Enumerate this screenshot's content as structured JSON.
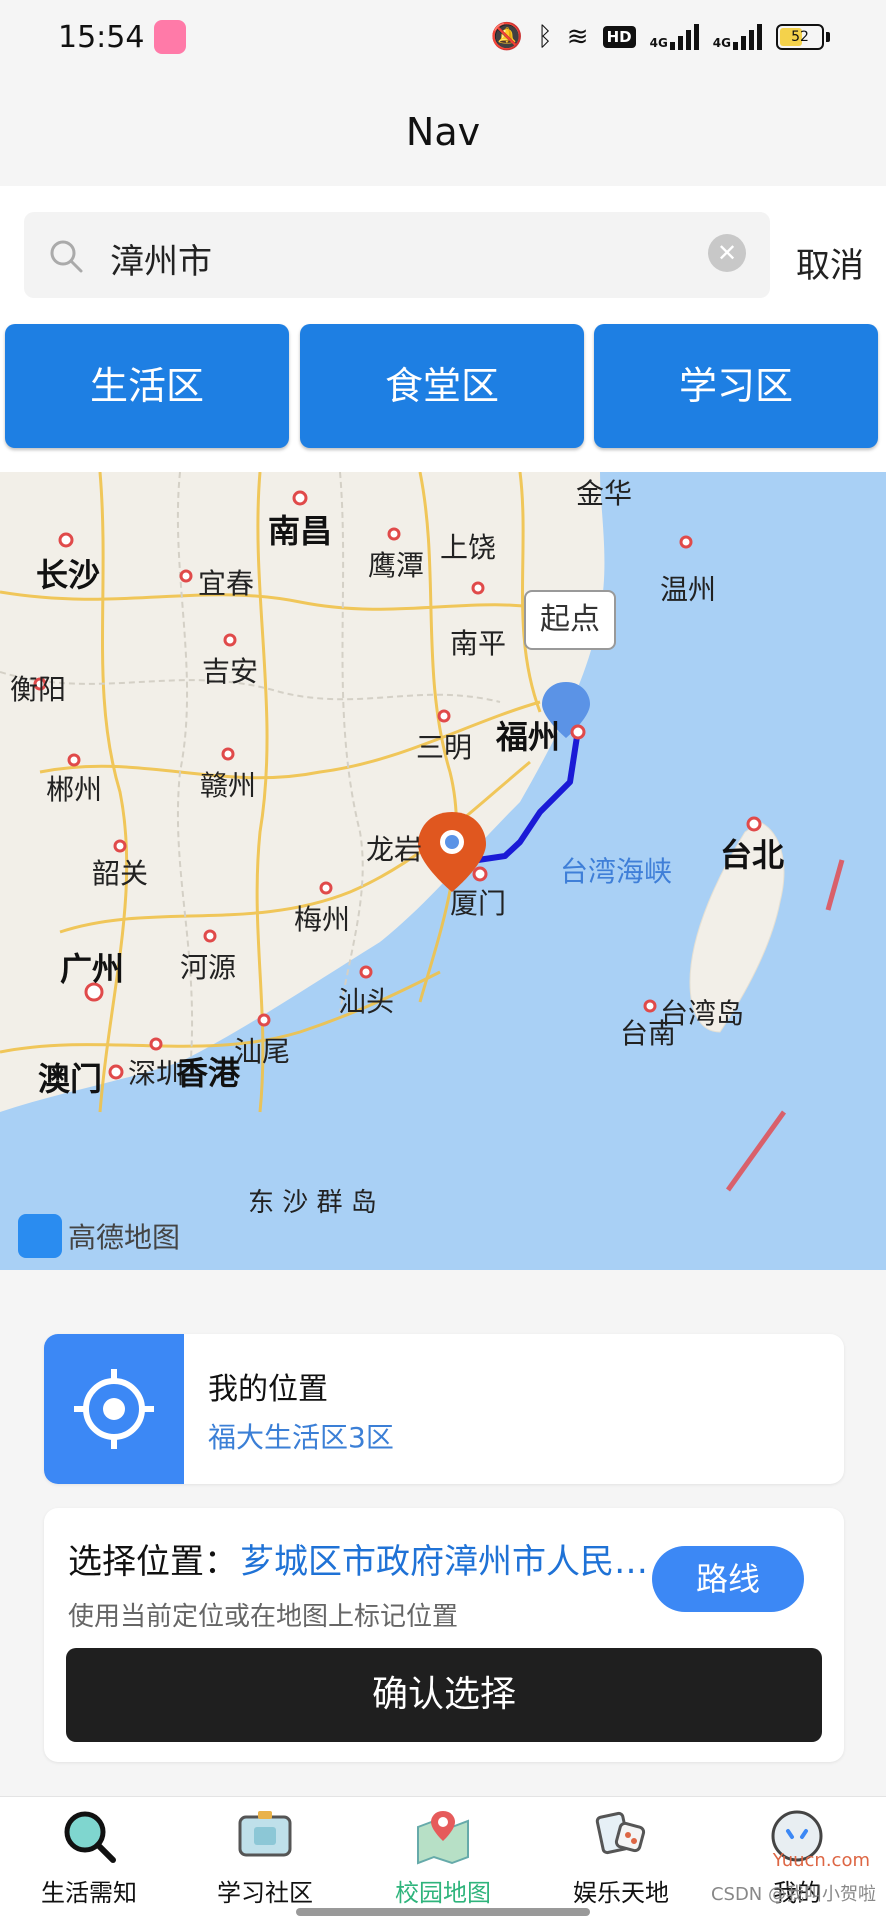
{
  "status_bar": {
    "time": "15:54",
    "icons": [
      "mute-icon",
      "bluetooth-icon",
      "wifi-icon",
      "hd-icon",
      "signal-4g-icon",
      "signal-4g-icon",
      "battery-icon"
    ],
    "hd_label": "HD",
    "network_label": "4G",
    "battery": "52"
  },
  "header": {
    "title": "Nav"
  },
  "search": {
    "value": "漳州市",
    "cancel_label": "取消"
  },
  "categories": [
    {
      "label": "生活区"
    },
    {
      "label": "食堂区"
    },
    {
      "label": "学习区"
    }
  ],
  "map": {
    "labels": [
      {
        "text": "南昌",
        "big": true
      },
      {
        "text": "长沙",
        "big": true
      },
      {
        "text": "宜春"
      },
      {
        "text": "鹰潭"
      },
      {
        "text": "上饶"
      },
      {
        "text": "金华"
      },
      {
        "text": "温州"
      },
      {
        "text": "南平"
      },
      {
        "text": "衡阳"
      },
      {
        "text": "吉安"
      },
      {
        "text": "三明"
      },
      {
        "text": "福州",
        "big": true
      },
      {
        "text": "郴州"
      },
      {
        "text": "赣州"
      },
      {
        "text": "龙岩"
      },
      {
        "text": "台北",
        "big": true
      },
      {
        "text": "韶关"
      },
      {
        "text": "梅州"
      },
      {
        "text": "厦门"
      },
      {
        "text": "广州",
        "big": true
      },
      {
        "text": "河源"
      },
      {
        "text": "汕头"
      },
      {
        "text": "台湾岛"
      },
      {
        "text": "台南"
      },
      {
        "text": "汕尾"
      },
      {
        "text": "深圳"
      },
      {
        "text": "香港",
        "big": true
      },
      {
        "text": "澳门",
        "big": true
      },
      {
        "text": "东 沙 群 岛"
      }
    ],
    "sea_label": "台湾海峡",
    "callout": "起点",
    "logo_text": "高德地图",
    "route_color": "#1a1ad6",
    "end_marker_color": "#e0571f",
    "start_marker_color": "#5b93e6"
  },
  "location_card": {
    "title": "我的位置",
    "subtitle": "福大生活区3区",
    "icon": "locate-icon"
  },
  "select_card": {
    "label": "选择位置：",
    "value": "芗城区市政府漳州市人民政府",
    "hint": "使用当前定位或在地图上标记位置",
    "route_label": "路线",
    "confirm_label": "确认选择"
  },
  "tabs": [
    {
      "label": "生活需知",
      "icon": "magnifier-icon",
      "active": false
    },
    {
      "label": "学习社区",
      "icon": "monitor-icon",
      "active": false
    },
    {
      "label": "校园地图",
      "icon": "map-icon",
      "active": true
    },
    {
      "label": "娱乐天地",
      "icon": "cards-icon",
      "active": false
    },
    {
      "label": "我的",
      "icon": "face-icon",
      "active": false
    }
  ],
  "watermark": "CSDN @我叫小贺啦",
  "watermark_site": "Yuucn.com",
  "colors": {
    "accent": "#1e7fe3",
    "active_tab": "#2fb47c",
    "link": "#1f72d6"
  }
}
